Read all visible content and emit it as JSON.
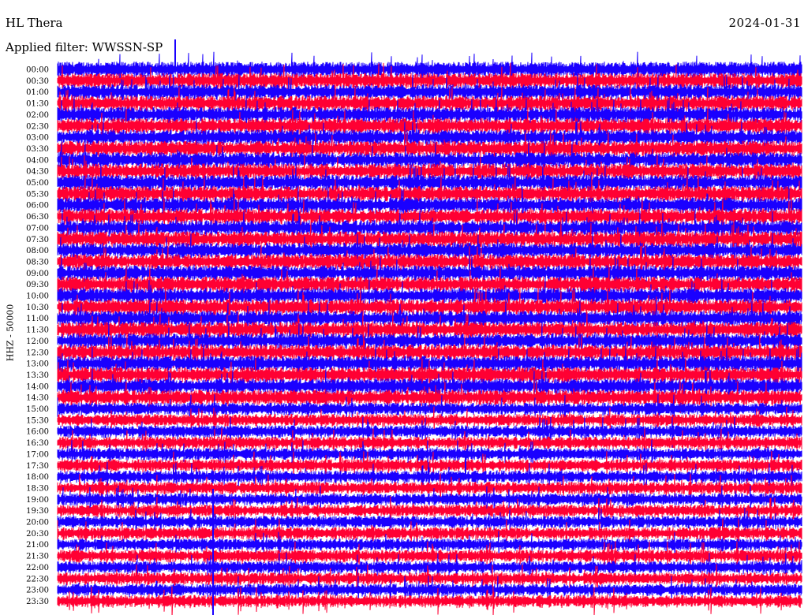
{
  "header": {
    "station": "HL Thera",
    "date": "2024-01-31",
    "filter_text": "Applied filter: WWSSN-SP"
  },
  "chart_data": {
    "type": "line",
    "title": "HL Thera",
    "ylabel": "HHZ - 50000",
    "row_interval": "30 min",
    "colors": [
      "#1a00ff",
      "#ff0033"
    ],
    "rows": [
      "00:00",
      "00:30",
      "01:00",
      "01:30",
      "02:00",
      "02:30",
      "03:00",
      "03:30",
      "04:00",
      "04:30",
      "05:00",
      "05:30",
      "06:00",
      "06:30",
      "07:00",
      "07:30",
      "08:00",
      "08:30",
      "09:00",
      "09:30",
      "10:00",
      "10:30",
      "11:00",
      "11:30",
      "12:00",
      "12:30",
      "13:00",
      "13:30",
      "14:00",
      "14:30",
      "15:00",
      "15:30",
      "16:00",
      "16:30",
      "17:00",
      "17:30",
      "18:00",
      "18:30",
      "19:00",
      "19:30",
      "20:00",
      "20:30",
      "21:00",
      "21:30",
      "22:00",
      "22:30",
      "23:00",
      "23:30"
    ]
  }
}
